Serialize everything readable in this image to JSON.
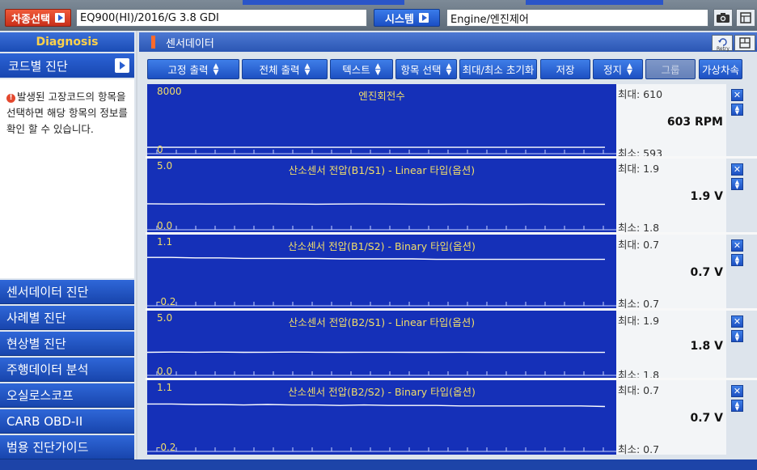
{
  "header": {
    "vehicle_select_label": "차종선택",
    "vehicle_value": "EQ900(HI)/2016/G 3.8 GDI",
    "system_label": "시스템",
    "system_value": "Engine/엔진제어"
  },
  "sidebar": {
    "title": "Diagnosis",
    "active_item": "코드별 진단",
    "info_text": "발생된 고장코드의 항목을 선택하면 해당 항목의 정보를 확인 할 수 있습니다.",
    "menu": [
      {
        "label": "센서데이터 진단"
      },
      {
        "label": "사례별 진단"
      },
      {
        "label": "현상별 진단"
      },
      {
        "label": "주행데이터 분석"
      },
      {
        "label": "오실로스코프"
      },
      {
        "label": "CARB OBD-II"
      },
      {
        "label": "범용 진단가이드"
      }
    ]
  },
  "section": {
    "title": "센서데이터",
    "retry_label": "Retry"
  },
  "toolbar": [
    {
      "label": "고정 출력",
      "dropdown": true,
      "disabled": false
    },
    {
      "label": "전체 출력",
      "dropdown": true,
      "disabled": false
    },
    {
      "label": "텍스트",
      "dropdown": true,
      "disabled": false
    },
    {
      "label": "항목 선택",
      "dropdown": true,
      "disabled": false
    },
    {
      "label": "최대/최소 초기화",
      "dropdown": false,
      "disabled": false
    },
    {
      "label": "저장",
      "dropdown": false,
      "disabled": false
    },
    {
      "label": "정지",
      "dropdown": true,
      "disabled": false
    },
    {
      "label": "그룹",
      "dropdown": false,
      "disabled": true
    },
    {
      "label": "가상차속",
      "dropdown": false,
      "disabled": false
    }
  ],
  "colors": {
    "graph_bg": "#1530b8",
    "graph_text": "#f1dd6a",
    "graph_line": "#ffffff",
    "accent_blue": "#1d50c2",
    "accent_orange": "#e04a2a"
  },
  "icons": {
    "camera": "camera-icon",
    "settings": "settings-icon",
    "close": "close-icon",
    "updown": "up-down-arrow-icon",
    "retry": "retry-icon",
    "layout": "layout-icon"
  },
  "chart_data": [
    {
      "type": "line",
      "title": "엔진회전수",
      "ylim": [
        0,
        8000
      ],
      "y_max_label": "8000",
      "y_min_label": "0",
      "values": [
        603,
        602,
        604,
        603,
        601,
        603,
        604,
        602,
        603,
        603,
        604,
        602,
        603,
        603,
        602,
        604,
        603,
        603,
        602,
        603
      ],
      "max_label": "최대: 610",
      "min_label": "최소: 593",
      "current": "603 RPM",
      "grid": false
    },
    {
      "type": "line",
      "title": "산소센서 전압(B1/S1) - Linear 타입(옵션)",
      "ylim": [
        0.0,
        5.0
      ],
      "y_max_label": "5.0",
      "y_min_label": "0.0",
      "values": [
        1.88,
        1.86,
        1.87,
        1.86,
        1.87,
        1.88,
        1.86,
        1.85,
        1.86,
        1.87,
        1.86,
        1.85,
        1.84,
        1.85,
        1.84,
        1.84,
        1.85,
        1.84,
        1.84,
        1.84
      ],
      "max_label": "최대: 1.9",
      "min_label": "최소: 1.8",
      "current": "1.9 V",
      "grid": false
    },
    {
      "type": "line",
      "title": "산소센서 전압(B1/S2) - Binary 타입(옵션)",
      "ylim": [
        -0.2,
        1.1
      ],
      "y_max_label": "1.1",
      "y_min_label": "-0.2",
      "values": [
        0.74,
        0.74,
        0.73,
        0.73,
        0.72,
        0.72,
        0.72,
        0.72,
        0.71,
        0.71,
        0.71,
        0.71,
        0.7,
        0.7,
        0.7,
        0.7,
        0.7,
        0.7,
        0.7,
        0.7
      ],
      "max_label": "최대: 0.7",
      "min_label": "최소: 0.7",
      "current": "0.7 V",
      "grid": false
    },
    {
      "type": "line",
      "title": "산소센서 전압(B2/S1) - Linear 타입(옵션)",
      "ylim": [
        0.0,
        5.0
      ],
      "y_max_label": "5.0",
      "y_min_label": "0.0",
      "values": [
        1.84,
        1.86,
        1.85,
        1.86,
        1.84,
        1.85,
        1.86,
        1.85,
        1.84,
        1.85,
        1.85,
        1.84,
        1.84,
        1.85,
        1.84,
        1.84,
        1.84,
        1.84,
        1.83,
        1.83
      ],
      "max_label": "최대: 1.9",
      "min_label": "최소: 1.8",
      "current": "1.8 V",
      "grid": false
    },
    {
      "type": "line",
      "title": "산소센서 전압(B2/S2) - Binary 타입(옵션)",
      "ylim": [
        -0.2,
        1.1
      ],
      "y_max_label": "1.1",
      "y_min_label": "-0.2",
      "values": [
        0.72,
        0.72,
        0.71,
        0.71,
        0.7,
        0.71,
        0.7,
        0.7,
        0.69,
        0.7,
        0.69,
        0.69,
        0.69,
        0.68,
        0.68,
        0.68,
        0.68,
        0.68,
        0.68,
        0.67
      ],
      "max_label": "최대: 0.7",
      "min_label": "최소: 0.7",
      "current": "0.7 V",
      "grid": false
    }
  ]
}
